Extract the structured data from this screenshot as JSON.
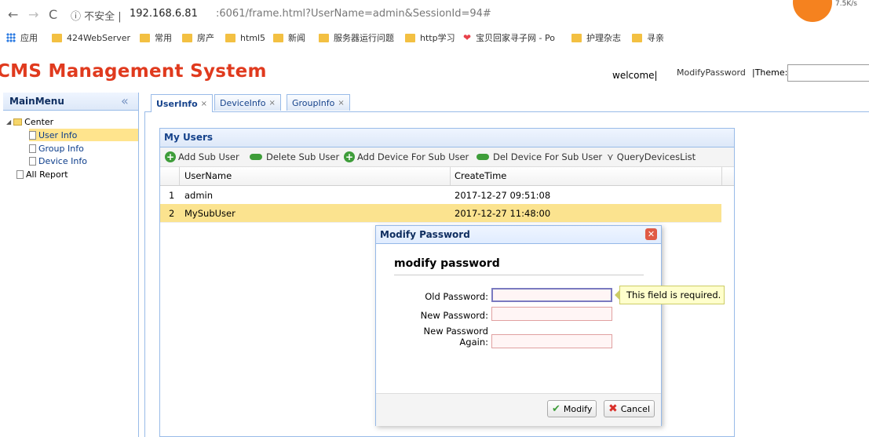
{
  "browser": {
    "url_lead": "ⓘ 不安全 |",
    "url_host": "192.168.6.81",
    "url_path": ":6061/frame.html?UserName=admin&SessionId=94#",
    "extension_text": "7.5K/s"
  },
  "bookmarks": [
    "应用",
    "424WebServer",
    "常用",
    "房产",
    "html5",
    "新闻",
    "服务器运行问题",
    "http学习",
    "宝贝回家寻子网 - Po",
    "护理杂志",
    "寻亲"
  ],
  "header": {
    "title": "CMS Management System",
    "welcome": "welcome|",
    "modify_password": "ModifyPassword",
    "theme_label": "|Theme:"
  },
  "menu": {
    "title": "MainMenu",
    "collapse": "«",
    "items": [
      {
        "label": "Center"
      },
      {
        "label": "User Info"
      },
      {
        "label": "Group Info"
      },
      {
        "label": "Device Info"
      },
      {
        "label": "All Report"
      }
    ]
  },
  "tabs": [
    {
      "label": "UserInfo"
    },
    {
      "label": "DeviceInfo"
    },
    {
      "label": "GroupInfo"
    }
  ],
  "grid": {
    "title": "My Users",
    "toolbar": [
      "Add Sub User",
      "Delete Sub User",
      "Add Device For Sub User",
      "Del Device For Sub User",
      "QueryDevicesList"
    ],
    "columns": [
      "UserName",
      "CreateTime"
    ],
    "rows": [
      {
        "num": "1",
        "username": "admin",
        "created": "2017-12-27 09:51:08"
      },
      {
        "num": "2",
        "username": "MySubUser",
        "created": "2017-12-27 11:48:00"
      }
    ]
  },
  "dialog": {
    "title": "Modify Password",
    "heading": "modify password",
    "old_label": "Old Password:",
    "new_label": "New Password:",
    "again_label_1": "New Password",
    "again_label_2": "Again:",
    "tooltip": "This field is required.",
    "modify": "Modify",
    "cancel": "Cancel"
  }
}
